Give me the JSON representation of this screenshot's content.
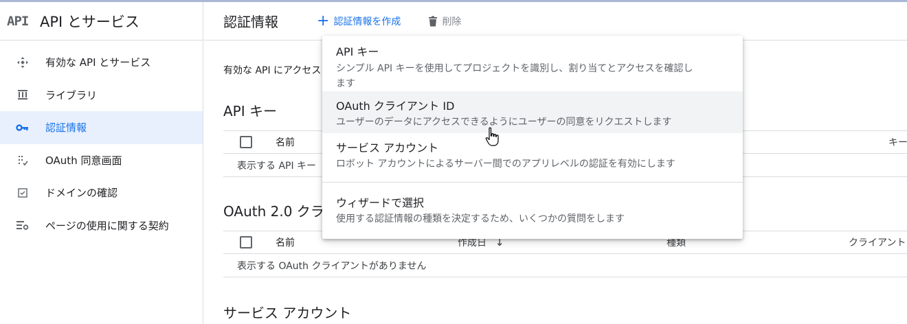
{
  "sidebar": {
    "logo": "API",
    "title": "API とサービス",
    "items": [
      {
        "label": "有効な API とサービス",
        "icon": "api-diamond-icon",
        "active": false
      },
      {
        "label": "ライブラリ",
        "icon": "library-icon",
        "active": false
      },
      {
        "label": "認証情報",
        "icon": "key-icon",
        "active": true
      },
      {
        "label": "OAuth 同意画面",
        "icon": "consent-icon",
        "active": false
      },
      {
        "label": "ドメインの確認",
        "icon": "checkbox-icon",
        "active": false
      },
      {
        "label": "ページの使用に関する契約",
        "icon": "settings-list-icon",
        "active": false
      }
    ]
  },
  "header": {
    "title": "認証情報",
    "create_label": "認証情報を作成",
    "delete_label": "削除"
  },
  "main": {
    "intro": "有効な API にアクセス",
    "api_keys": {
      "title": "API キー",
      "col_name": "名前",
      "col_key": "キー",
      "empty": "表示する API キー"
    },
    "oauth": {
      "title": "OAuth 2.0 クラ",
      "col_name": "名前",
      "col_created": "作成日",
      "col_type": "種類",
      "col_client": "クライアント",
      "empty": "表示する OAuth クライアントがありません"
    },
    "service_accounts": {
      "title": "サービス アカウント"
    }
  },
  "dropdown": {
    "items": [
      {
        "title": "API キー",
        "desc_line1": "シンプル API キーを使用してプロジェクトを識別し、割り当てとアクセスを確認し",
        "desc_line2": "ます"
      },
      {
        "title": "OAuth クライアント ID",
        "desc_line1": "ユーザーのデータにアクセスできるようにユーザーの同意をリクエストします"
      },
      {
        "title": "サービス アカウント",
        "desc_line1": "ロボット アカウントによるサーバー間でのアプリレベルの認証を有効にします"
      },
      {
        "title": "ウィザードで選択",
        "desc_line1": "使用する認証情報の種類を決定するため、いくつかの質問をします"
      }
    ]
  },
  "colors": {
    "accent": "#1a73e8",
    "active_bg": "#e8f0fe",
    "hover_bg": "#f1f3f4",
    "divider": "#dadce0"
  }
}
